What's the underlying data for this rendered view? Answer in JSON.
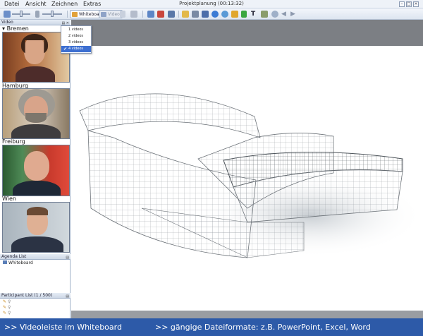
{
  "menubar": {
    "items": [
      "Datei",
      "Ansicht",
      "Zeichnen",
      "Extras"
    ],
    "title": "Projektplanung (00:13:32)",
    "window_controls": [
      "minimize-icon",
      "maximize-icon",
      "close-icon"
    ]
  },
  "toolbar": {
    "whiteboard_label": "Whiteboard",
    "video_label": "Video",
    "icons": [
      "speaker-icon",
      "microphone-icon",
      "whiteboard-icon",
      "video-icon",
      "screen-icon",
      "share-icon",
      "record-icon",
      "window-icon",
      "folder-icon",
      "print-icon",
      "save-icon",
      "zoom-icon",
      "refresh-icon",
      "pen-icon",
      "check-icon",
      "text-icon",
      "layers-icon",
      "magnifier-icon",
      "arrow-left-icon",
      "arrow-right-icon"
    ]
  },
  "video_panel": {
    "title": "Video",
    "sites": [
      {
        "name": "Bremen"
      },
      {
        "name": "Hamburg"
      },
      {
        "name": "Freiburg"
      },
      {
        "name": "Wien"
      }
    ]
  },
  "video_dropdown": {
    "options": [
      "1 videos",
      "2 videos",
      "3 videos",
      "4 videos"
    ],
    "selected": "4 videos"
  },
  "agenda": {
    "title": "Agenda List",
    "items": [
      "Whiteboard"
    ]
  },
  "participants": {
    "title": "Participant List (1 / 500)"
  },
  "footer": {
    "left": ">> Videoleiste im Whiteboard",
    "right": ">> gängige Dateiformate: z.B. PowerPoint, Excel, Word"
  },
  "colors": {
    "footer_bg": "#2d5aa8",
    "selection": "#3d6fd1",
    "canvas_frame": "#7c7f84"
  }
}
